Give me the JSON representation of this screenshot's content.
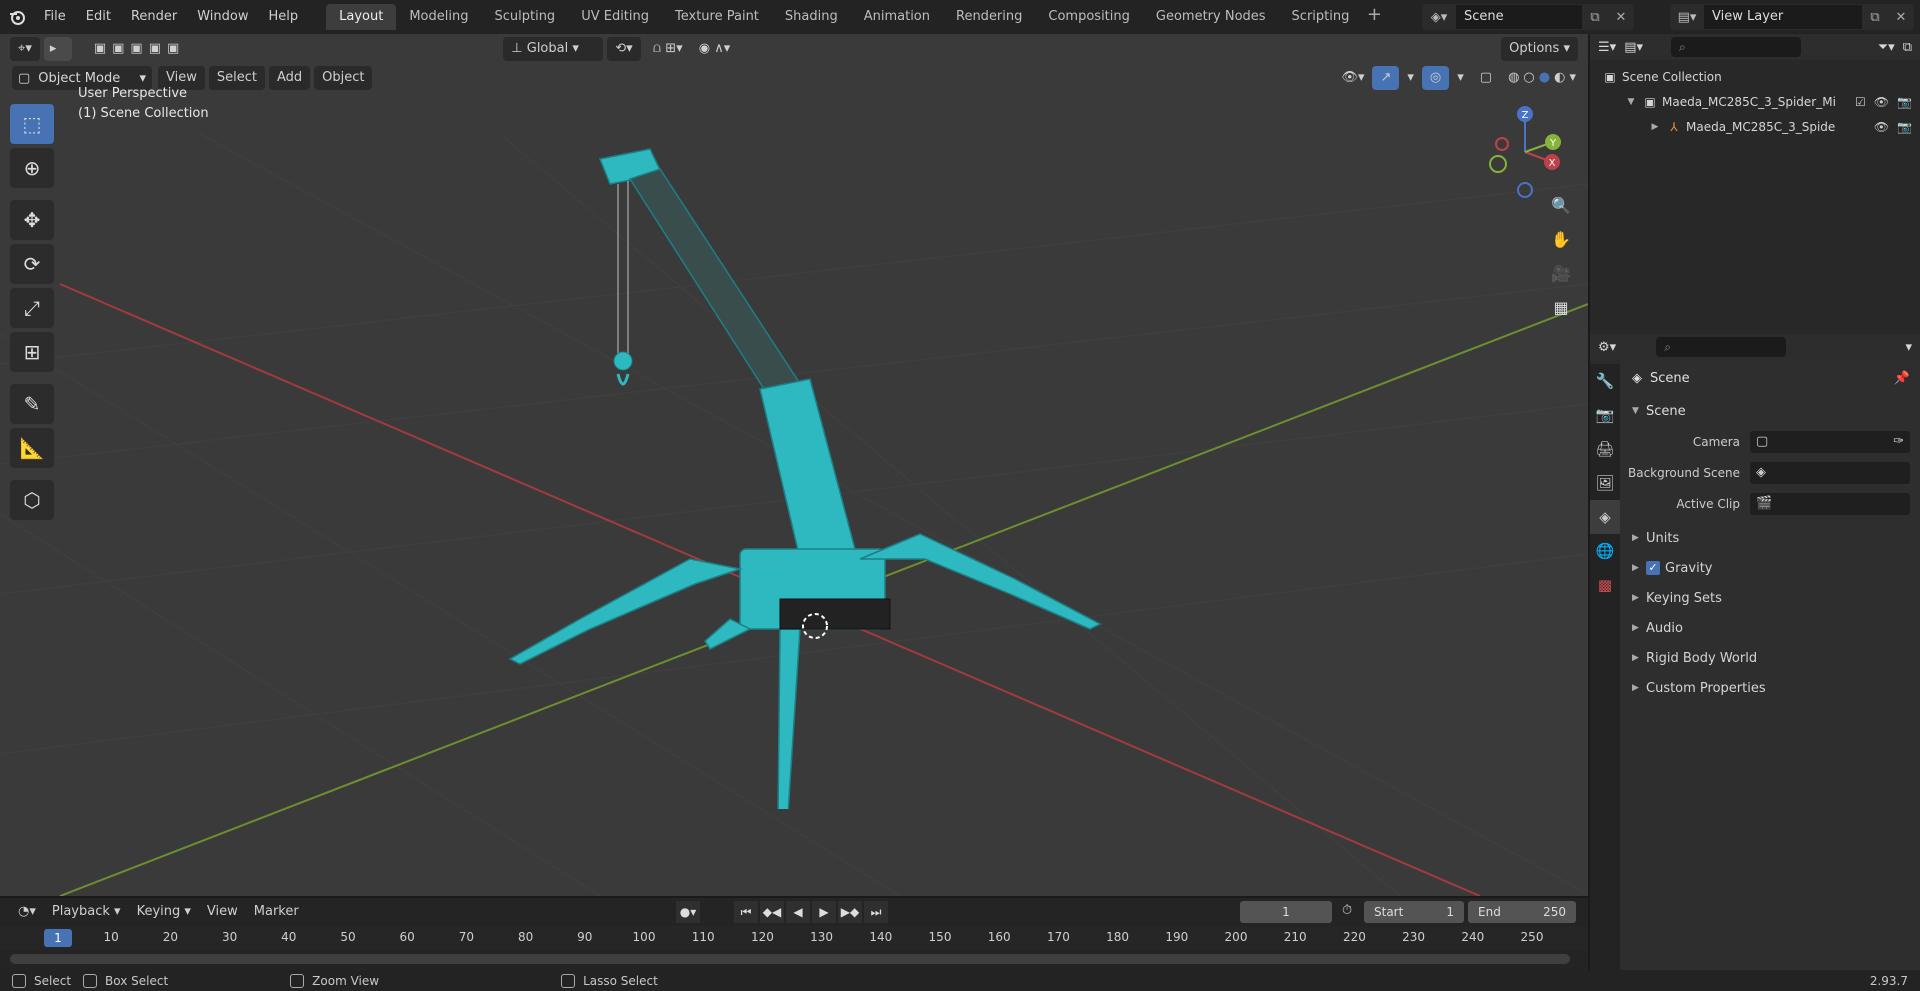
{
  "menu": [
    "File",
    "Edit",
    "Render",
    "Window",
    "Help"
  ],
  "workspaces": [
    "Layout",
    "Modeling",
    "Sculpting",
    "UV Editing",
    "Texture Paint",
    "Shading",
    "Animation",
    "Rendering",
    "Compositing",
    "Geometry Nodes",
    "Scripting"
  ],
  "active_workspace": "Layout",
  "scene_name": "Scene",
  "view_layer": "View Layer",
  "viewport": {
    "transform_orientation": "Global",
    "options_label": "Options",
    "mode": "Object Mode",
    "menus": [
      "View",
      "Select",
      "Add",
      "Object"
    ],
    "overlay_line1": "User Perspective",
    "overlay_line2": "(1) Scene Collection",
    "gizmo": {
      "x": "X",
      "y": "Y",
      "z": "Z"
    }
  },
  "outliner": {
    "root": "Scene Collection",
    "collection": "Maeda_MC285C_3_Spider_Mi",
    "object": "Maeda_MC285C_3_Spide"
  },
  "properties": {
    "title": "Scene",
    "section": "Scene",
    "fields": {
      "camera": "Camera",
      "background_scene": "Background Scene",
      "active_clip": "Active Clip"
    },
    "subsections": {
      "units": "Units",
      "gravity": "Gravity",
      "keying_sets": "Keying Sets",
      "audio": "Audio",
      "rigid_body_world": "Rigid Body World",
      "custom_properties": "Custom Properties"
    }
  },
  "timeline": {
    "menus": [
      "Playback",
      "Keying",
      "View",
      "Marker"
    ],
    "current_frame": "1",
    "start_label": "Start",
    "start_value": "1",
    "end_label": "End",
    "end_value": "250",
    "ticks": [
      "10",
      "20",
      "30",
      "40",
      "50",
      "60",
      "70",
      "80",
      "90",
      "100",
      "110",
      "120",
      "130",
      "140",
      "150",
      "160",
      "170",
      "180",
      "190",
      "200",
      "210",
      "220",
      "230",
      "240",
      "250"
    ],
    "cursor_label": "1"
  },
  "status": {
    "select": "Select",
    "box_select": "Box Select",
    "zoom_view": "Zoom View",
    "lasso_select": "Lasso Select",
    "version": "2.93.7"
  },
  "colors": {
    "accent": "#4772b3",
    "model": "#2eb8bf",
    "x_axis": "#c0404a",
    "y_axis": "#86b33a"
  }
}
